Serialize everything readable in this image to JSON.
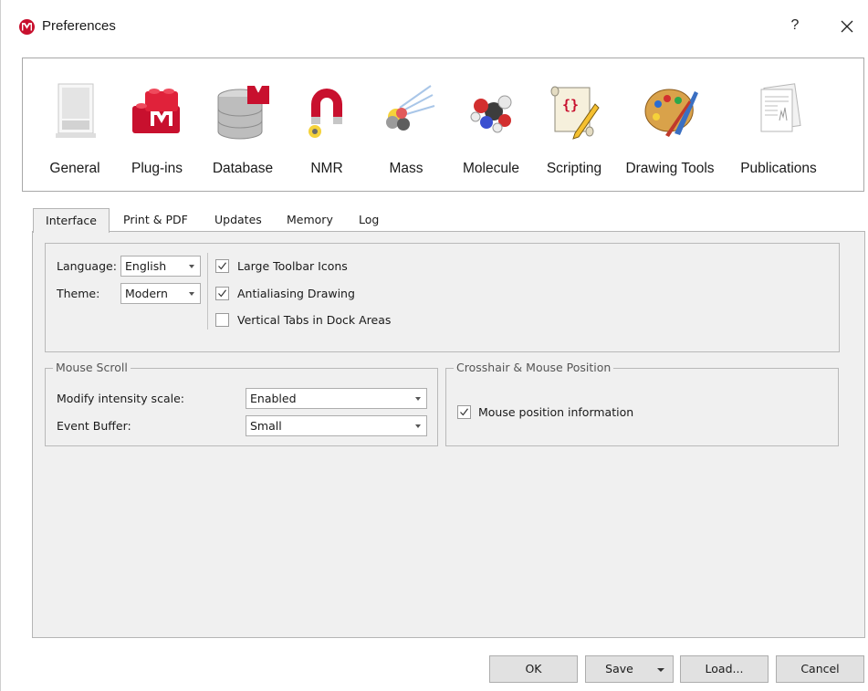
{
  "window": {
    "title": "Preferences",
    "help_label": "?",
    "close_icon": "close-icon"
  },
  "categories": [
    {
      "label": "General",
      "icon": "general-icon"
    },
    {
      "label": "Plug-ins",
      "icon": "plugins-icon"
    },
    {
      "label": "Database",
      "icon": "database-icon"
    },
    {
      "label": "NMR",
      "icon": "nmr-magnet-icon"
    },
    {
      "label": "Mass",
      "icon": "mass-icon"
    },
    {
      "label": "Molecule",
      "icon": "molecule-icon"
    },
    {
      "label": "Scripting",
      "icon": "scripting-icon"
    },
    {
      "label": "Drawing Tools",
      "icon": "palette-icon"
    },
    {
      "label": "Publications",
      "icon": "publications-icon"
    }
  ],
  "tabs": [
    {
      "label": "Interface",
      "active": true
    },
    {
      "label": "Print & PDF",
      "active": false
    },
    {
      "label": "Updates",
      "active": false
    },
    {
      "label": "Memory",
      "active": false
    },
    {
      "label": "Log",
      "active": false
    }
  ],
  "interface": {
    "language_label": "Language:",
    "language_value": "English",
    "theme_label": "Theme:",
    "theme_value": "Modern",
    "options": [
      {
        "label": "Large Toolbar Icons",
        "checked": true
      },
      {
        "label": "Antialiasing Drawing",
        "checked": true
      },
      {
        "label": "Vertical Tabs in Dock Areas",
        "checked": false
      }
    ]
  },
  "mouse_scroll": {
    "title": "Mouse Scroll",
    "intensity_label": "Modify intensity scale:",
    "intensity_value": "Enabled",
    "buffer_label": "Event Buffer:",
    "buffer_value": "Small"
  },
  "crosshair": {
    "title": "Crosshair & Mouse Position",
    "mouse_position_label": "Mouse position information",
    "mouse_position_checked": true
  },
  "footer": {
    "ok": "OK",
    "save": "Save",
    "load": "Load...",
    "cancel": "Cancel"
  },
  "colors": {
    "brand_red": "#c8102e",
    "panel_bg": "#f0f0f0",
    "button_bg": "#e1e1e1"
  }
}
